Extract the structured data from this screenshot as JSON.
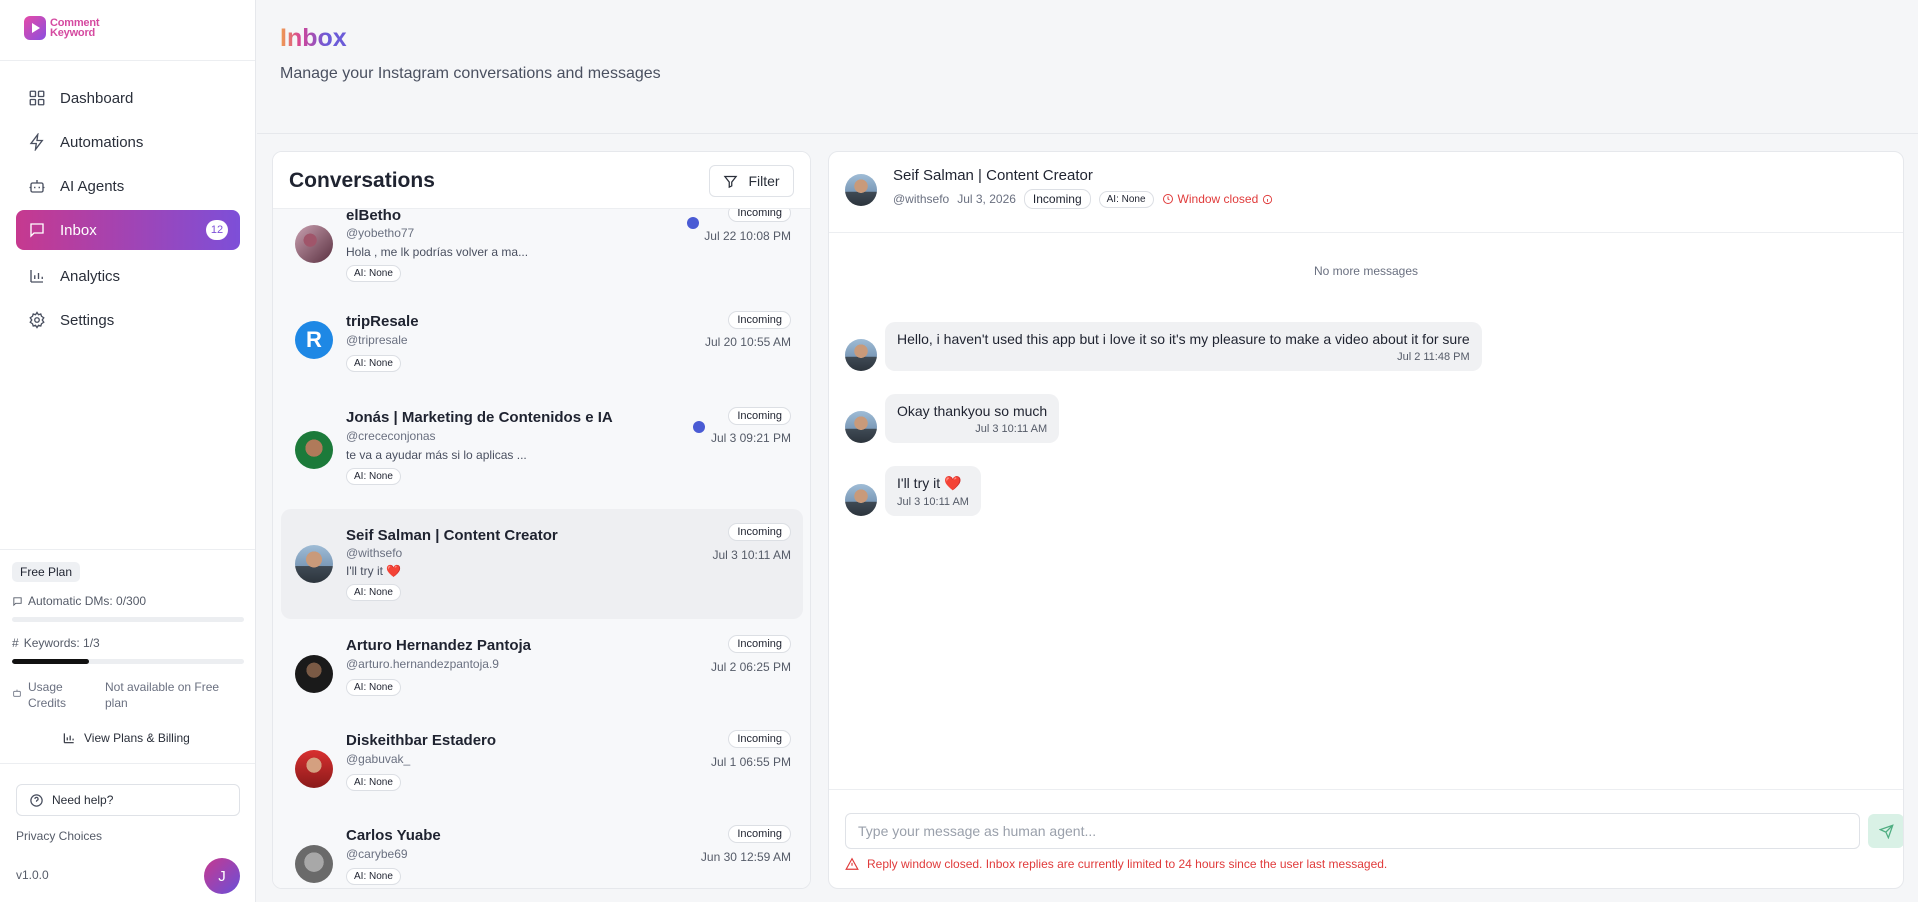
{
  "app": {
    "logo_line1": "Comment",
    "logo_line2": "Keyword"
  },
  "sidebar": {
    "items": [
      {
        "label": "Dashboard",
        "icon": "grid-icon"
      },
      {
        "label": "Automations",
        "icon": "lightning-icon"
      },
      {
        "label": "AI Agents",
        "icon": "robot-icon"
      },
      {
        "label": "Inbox",
        "icon": "chat-icon",
        "badge": "12",
        "active": true
      },
      {
        "label": "Analytics",
        "icon": "bar-chart-icon"
      },
      {
        "label": "Settings",
        "icon": "gear-icon"
      }
    ],
    "plan": "Free Plan",
    "automatic_dms": "Automatic DMs: 0/300",
    "automatic_dms_fraction": 0,
    "keywords": "Keywords: 1/3",
    "keywords_fraction": 0.333,
    "usage_credits_label": "Usage Credits",
    "usage_credits_value": "Not available on Free plan",
    "view_plans": "View Plans & Billing",
    "need_help": "Need help?",
    "privacy": "Privacy Choices",
    "version": "v1.0.0",
    "user_initial": "J"
  },
  "header": {
    "title": "Inbox",
    "subtitle": "Manage your Instagram conversations and messages"
  },
  "conversations": {
    "title": "Conversations",
    "filter_label": "Filter",
    "items": [
      {
        "name": "elBetho",
        "handle": "@yobetho77",
        "preview": "Hola , me lk podrías volver a ma...",
        "status": "Incoming",
        "time": "Jul 22 10:08 PM",
        "ai": "AI: None",
        "unread": true
      },
      {
        "name": "tripResale",
        "handle": "@tripresale",
        "preview": "",
        "status": "Incoming",
        "time": "Jul 20 10:55 AM",
        "ai": "AI: None",
        "unread": false
      },
      {
        "name": "Jonás | Marketing de Contenidos e IA",
        "handle": "@crececonjonas",
        "preview": "te va a ayudar más si lo aplicas ...",
        "status": "Incoming",
        "time": "Jul 3 09:21 PM",
        "ai": "AI: None",
        "unread": true
      },
      {
        "name": "Seif Salman | Content Creator",
        "handle": "@withsefo",
        "preview": "I'll try it ❤️",
        "status": "Incoming",
        "time": "Jul 3 10:11 AM",
        "ai": "AI: None",
        "unread": false,
        "selected": true
      },
      {
        "name": "Arturo Hernandez Pantoja",
        "handle": "@arturo.hernandezpantoja.9",
        "preview": "",
        "status": "Incoming",
        "time": "Jul 2 06:25 PM",
        "ai": "AI: None",
        "unread": false
      },
      {
        "name": "Diskeithbar Estadero",
        "handle": "@gabuvak_",
        "preview": "",
        "status": "Incoming",
        "time": "Jul 1 06:55 PM",
        "ai": "AI: None",
        "unread": false
      },
      {
        "name": "Carlos Yuabe",
        "handle": "@carybe69",
        "preview": "",
        "status": "Incoming",
        "time": "Jun 30 12:59 AM",
        "ai": "AI: None",
        "unread": false
      }
    ]
  },
  "chat": {
    "name": "Seif Salman | Content Creator",
    "handle": "@withsefo",
    "date": "Jul 3, 2026",
    "status": "Incoming",
    "ai": "AI: None",
    "window": "Window closed",
    "no_more": "No more messages",
    "messages": [
      {
        "text": "Hello, i haven't used this app but i love it so it's my pleasure to make a video about it for sure",
        "time": "Jul 2 11:48 PM"
      },
      {
        "text": "Okay thankyou so much",
        "time": "Jul 3 10:11 AM"
      },
      {
        "text": "I'll try it ❤️",
        "time": "Jul 3 10:11 AM"
      }
    ],
    "input_placeholder": "Type your message as human agent...",
    "warning": "Reply window closed. Inbox replies are currently limited to 24 hours since the user last messaged."
  },
  "colors": {
    "accent_start": "#c6398f",
    "accent_end": "#7d4fd8",
    "unread_dot": "#4a5bd4",
    "warning_red": "#e03b3b"
  }
}
